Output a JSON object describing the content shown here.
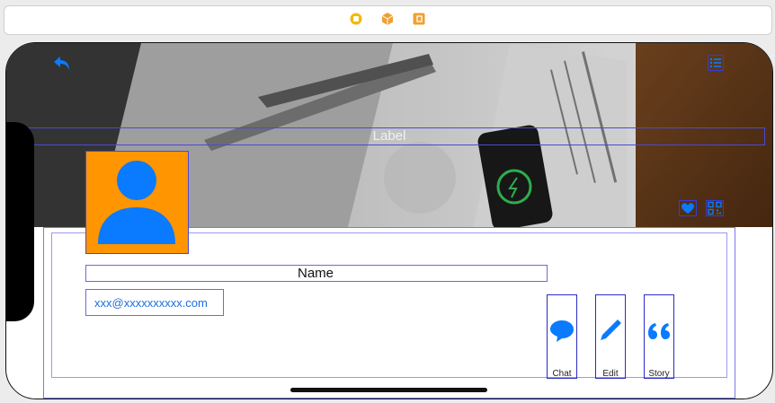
{
  "toolbar": {
    "icons": [
      "circle-record-icon",
      "cube-icon",
      "exit-square-icon"
    ],
    "colors": {
      "yellow": "#f5b800",
      "orange": "#f0a032"
    }
  },
  "header": {
    "label": "Label",
    "icons": [
      "back-arrow-icon",
      "list-icon",
      "heart-icon",
      "qr-code-icon"
    ]
  },
  "profile": {
    "name": "Name",
    "email": "xxx@xxxxxxxxxx.com",
    "avatar_colors": {
      "background": "#ff9500",
      "figure": "#0a7aff"
    }
  },
  "actions": [
    {
      "label": "Chat",
      "icon": "speech-bubble-icon"
    },
    {
      "label": "Edit",
      "icon": "pencil-icon"
    },
    {
      "label": "Story",
      "icon": "quote-icon"
    }
  ],
  "accent": "#0a7aff"
}
